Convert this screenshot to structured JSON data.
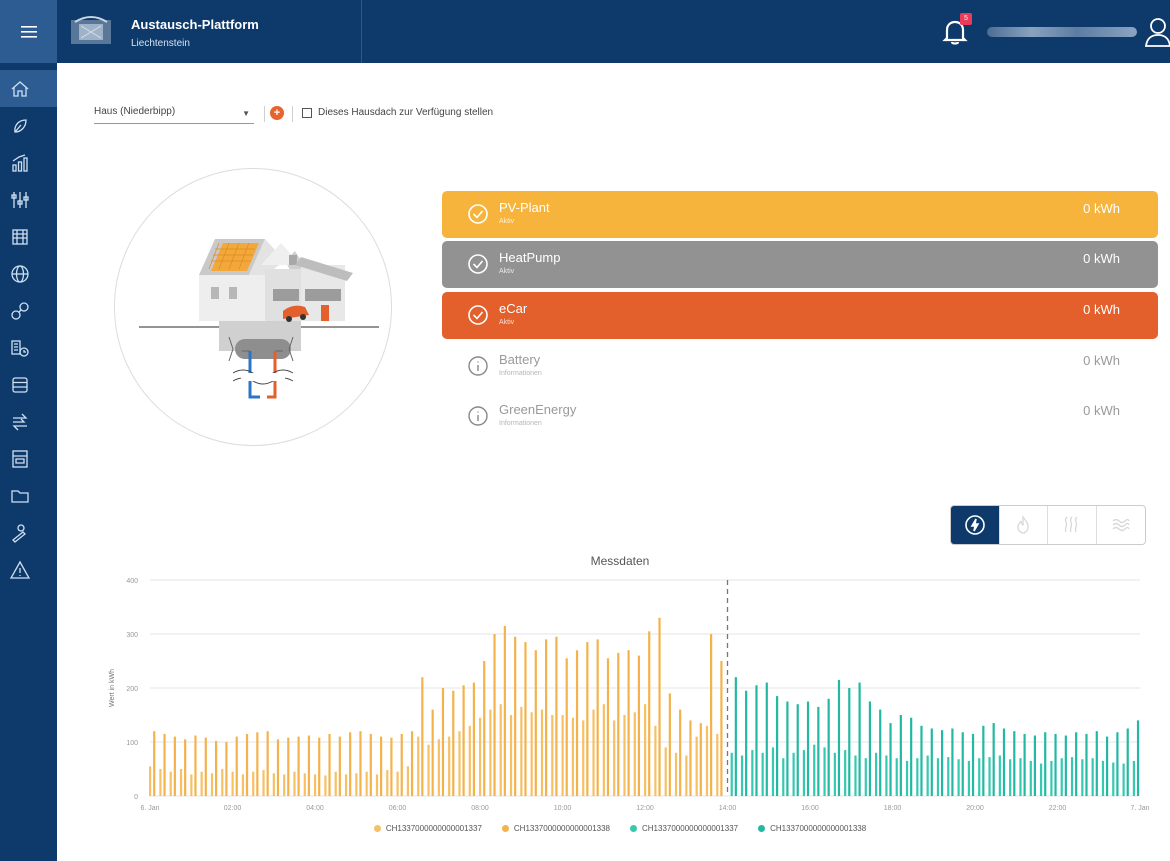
{
  "app": {
    "title": "Austausch-Plattform",
    "subtitle": "Liechtenstein",
    "notification_count": "5"
  },
  "sidebar": {
    "items": [
      {
        "icon": "home-icon",
        "active": true
      },
      {
        "icon": "leaf-icon"
      },
      {
        "icon": "chart-bars-icon"
      },
      {
        "icon": "sliders-icon"
      },
      {
        "icon": "store-icon"
      },
      {
        "icon": "globe-icon"
      },
      {
        "icon": "network-icon"
      },
      {
        "icon": "building-clock-icon"
      },
      {
        "icon": "server-icon"
      },
      {
        "icon": "exchange-icon"
      },
      {
        "icon": "cabinet-icon"
      },
      {
        "icon": "folder-icon"
      },
      {
        "icon": "user-edit-icon"
      },
      {
        "icon": "warning-icon"
      }
    ]
  },
  "controls": {
    "house_select_value": "Haus (Niederbipp)",
    "share_roof_label": "Dieses Hausdach zur Verfügung stellen"
  },
  "devices": [
    {
      "name": "PV-Plant",
      "status": "Aktiv",
      "value": "0 kWh",
      "color": "#f7b43c",
      "active": true
    },
    {
      "name": "HeatPump",
      "status": "Aktiv",
      "value": "0 kWh",
      "color": "#929292",
      "active": true
    },
    {
      "name": "eCar",
      "status": "Aktiv",
      "value": "0 kWh",
      "color": "#e35f2c",
      "active": true
    },
    {
      "name": "Battery",
      "status": "Informationen",
      "value": "0 kWh",
      "active": false
    },
    {
      "name": "GreenEnergy",
      "status": "Informationen",
      "value": "0 kWh",
      "active": false
    }
  ],
  "energy_toggles": [
    {
      "icon": "lightning-icon",
      "active": true
    },
    {
      "icon": "flame-icon"
    },
    {
      "icon": "heat-icon"
    },
    {
      "icon": "water-waves-icon"
    }
  ],
  "chart_data": {
    "type": "bar",
    "title": "Messdaten",
    "ylabel": "Wert in kWh",
    "xlabel": "",
    "ylim": [
      0,
      400
    ],
    "yticks": [
      "0",
      "100",
      "200",
      "300",
      "400"
    ],
    "xticks": [
      "6. Jan",
      "02:00",
      "04:00",
      "06:00",
      "08:00",
      "10:00",
      "12:00",
      "14:00",
      "16:00",
      "18:00",
      "20:00",
      "22:00",
      "7. Jan"
    ],
    "x_range_hours": [
      0,
      24
    ],
    "now_marker_hour": 14,
    "series": [
      {
        "name": "CH1337000000000001337",
        "color": "#f7c065",
        "x_hours": [
          0,
          0.25,
          0.5,
          0.75,
          1,
          1.25,
          1.5,
          1.75,
          2,
          2.25,
          2.5,
          2.75,
          3,
          3.25,
          3.5,
          3.75,
          4,
          4.25,
          4.5,
          4.75,
          5,
          5.25,
          5.5,
          5.75,
          6,
          6.25,
          6.5,
          6.75,
          7,
          7.25,
          7.5,
          7.75,
          8,
          8.25,
          8.5,
          8.75,
          9,
          9.25,
          9.5,
          9.75,
          10,
          10.25,
          10.5,
          10.75,
          11,
          11.25,
          11.5,
          11.75,
          12,
          12.25,
          12.5,
          12.75,
          13,
          13.25,
          13.5,
          13.75
        ],
        "values": [
          55,
          50,
          45,
          50,
          40,
          45,
          42,
          50,
          45,
          40,
          45,
          48,
          42,
          40,
          45,
          42,
          40,
          38,
          45,
          40,
          42,
          45,
          40,
          48,
          45,
          55,
          110,
          95,
          105,
          110,
          120,
          130,
          145,
          160,
          170,
          150,
          165,
          155,
          160,
          150,
          150,
          145,
          140,
          160,
          170,
          140,
          150,
          155,
          170,
          130,
          90,
          80,
          75,
          110,
          130,
          115
        ]
      },
      {
        "name": "CH1337000000000001338",
        "color": "#f4b24c",
        "x_hours": [
          0.1,
          0.35,
          0.6,
          0.85,
          1.1,
          1.35,
          1.6,
          1.85,
          2.1,
          2.35,
          2.6,
          2.85,
          3.1,
          3.35,
          3.6,
          3.85,
          4.1,
          4.35,
          4.6,
          4.85,
          5.1,
          5.35,
          5.6,
          5.85,
          6.1,
          6.35,
          6.6,
          6.85,
          7.1,
          7.35,
          7.6,
          7.85,
          8.1,
          8.35,
          8.6,
          8.85,
          9.1,
          9.35,
          9.6,
          9.85,
          10.1,
          10.35,
          10.6,
          10.85,
          11.1,
          11.35,
          11.6,
          11.85,
          12.1,
          12.35,
          12.6,
          12.85,
          13.1,
          13.35,
          13.6,
          13.85
        ],
        "values": [
          120,
          115,
          110,
          105,
          112,
          108,
          102,
          100,
          110,
          115,
          118,
          120,
          105,
          108,
          110,
          112,
          108,
          115,
          110,
          118,
          120,
          115,
          110,
          108,
          115,
          120,
          220,
          160,
          200,
          195,
          205,
          210,
          250,
          300,
          315,
          295,
          285,
          270,
          290,
          295,
          255,
          270,
          285,
          290,
          255,
          265,
          270,
          260,
          305,
          330,
          190,
          160,
          140,
          135,
          300,
          250
        ]
      },
      {
        "name": "CH1337000000000001337",
        "color": "#35c9b0",
        "x_hours": [
          14.1,
          14.35,
          14.6,
          14.85,
          15.1,
          15.35,
          15.6,
          15.85,
          16.1,
          16.35,
          16.6,
          16.85,
          17.1,
          17.35,
          17.6,
          17.85,
          18.1,
          18.35,
          18.6,
          18.85,
          19.1,
          19.35,
          19.6,
          19.85,
          20.1,
          20.35,
          20.6,
          20.85,
          21.1,
          21.35,
          21.6,
          21.85,
          22.1,
          22.35,
          22.6,
          22.85,
          23.1,
          23.35,
          23.6,
          23.85
        ],
        "values": [
          80,
          75,
          85,
          80,
          90,
          70,
          80,
          85,
          95,
          90,
          80,
          85,
          75,
          70,
          80,
          75,
          70,
          65,
          70,
          75,
          70,
          72,
          68,
          65,
          70,
          72,
          75,
          68,
          70,
          65,
          60,
          65,
          70,
          72,
          68,
          70,
          65,
          62,
          60,
          65
        ]
      },
      {
        "name": "CH1337000000000001338",
        "color": "#22b8a3",
        "x_hours": [
          14.2,
          14.45,
          14.7,
          14.95,
          15.2,
          15.45,
          15.7,
          15.95,
          16.2,
          16.45,
          16.7,
          16.95,
          17.2,
          17.45,
          17.7,
          17.95,
          18.2,
          18.45,
          18.7,
          18.95,
          19.2,
          19.45,
          19.7,
          19.95,
          20.2,
          20.45,
          20.7,
          20.95,
          21.2,
          21.45,
          21.7,
          21.95,
          22.2,
          22.45,
          22.7,
          22.95,
          23.2,
          23.45,
          23.7,
          23.95
        ],
        "values": [
          220,
          195,
          205,
          210,
          185,
          175,
          170,
          175,
          165,
          180,
          215,
          200,
          210,
          175,
          160,
          135,
          150,
          145,
          130,
          125,
          122,
          125,
          118,
          115,
          130,
          135,
          125,
          120,
          115,
          112,
          118,
          115,
          112,
          118,
          115,
          120,
          110,
          118,
          125,
          140
        ]
      }
    ]
  },
  "legend": [
    "CH1337000000000001337",
    "CH1337000000000001338",
    "CH1337000000000001337",
    "CH1337000000000001338"
  ]
}
